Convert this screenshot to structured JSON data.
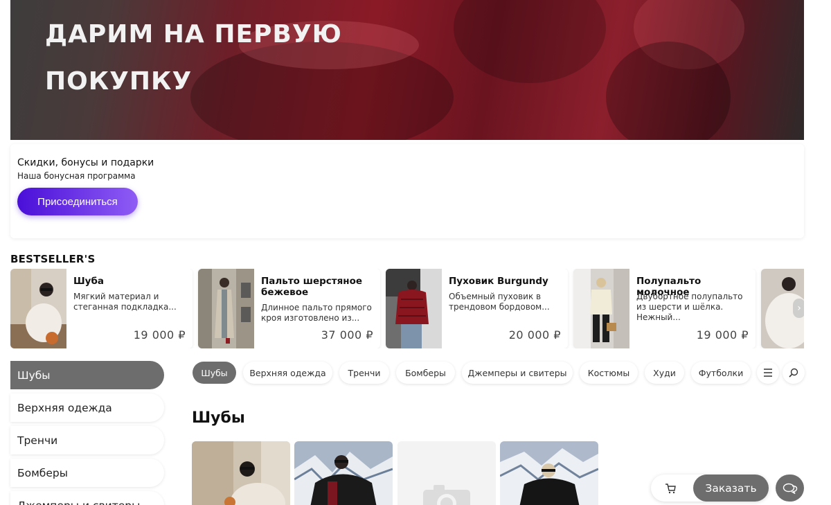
{
  "hero": {
    "line1": "ДАРИМ НА ПЕРВУЮ",
    "line2": "ПОКУПКУ"
  },
  "bonus": {
    "title": "Скидки, бонусы и подарки",
    "subtitle": "Наша бонусная программа",
    "button_label": "Присоединиться"
  },
  "bestsellers": {
    "title": "BESTSELLER'S",
    "items": [
      {
        "name": "Шуба",
        "desc": "Мягкий материал и стеганная подкладка...",
        "price": "19 000 ₽"
      },
      {
        "name": "Пальто шерстяное бежевое",
        "desc": "Длинное пальто прямого кроя изготовлено из...",
        "price": "37 000 ₽"
      },
      {
        "name": "Пуховик Burgundy",
        "desc": "Объемный пуховик в трендовом бордовом...",
        "price": "20 000 ₽"
      },
      {
        "name": "Полупальто молочное",
        "desc": "Двубортное полупальто из шерсти и шёлка. Нежный...",
        "price": "19 000 ₽"
      }
    ]
  },
  "sidebar": {
    "items": [
      {
        "label": "Шубы",
        "active": true
      },
      {
        "label": "Верхняя одежда",
        "active": false
      },
      {
        "label": "Тренчи",
        "active": false
      },
      {
        "label": "Бомберы",
        "active": false
      },
      {
        "label": "Джемперы и свитеры",
        "active": false
      }
    ]
  },
  "categories": {
    "chips": [
      "Шубы",
      "Верхняя одежда",
      "Тренчи",
      "Бомберы",
      "Джемперы и свитеры",
      "Костюмы",
      "Худи",
      "Футболки"
    ],
    "active_index": 0,
    "menu_icon": "menu-icon",
    "search_icon": "search-icon"
  },
  "section": {
    "title": "Шубы"
  },
  "floating": {
    "order_label": "Заказать",
    "cart_icon": "cart-icon",
    "chat_icon": "chat-icon"
  },
  "colors": {
    "accent": "#6d6d6d",
    "join_gradient_start": "#4a0fd8",
    "join_gradient_end": "#8f5cf5"
  }
}
